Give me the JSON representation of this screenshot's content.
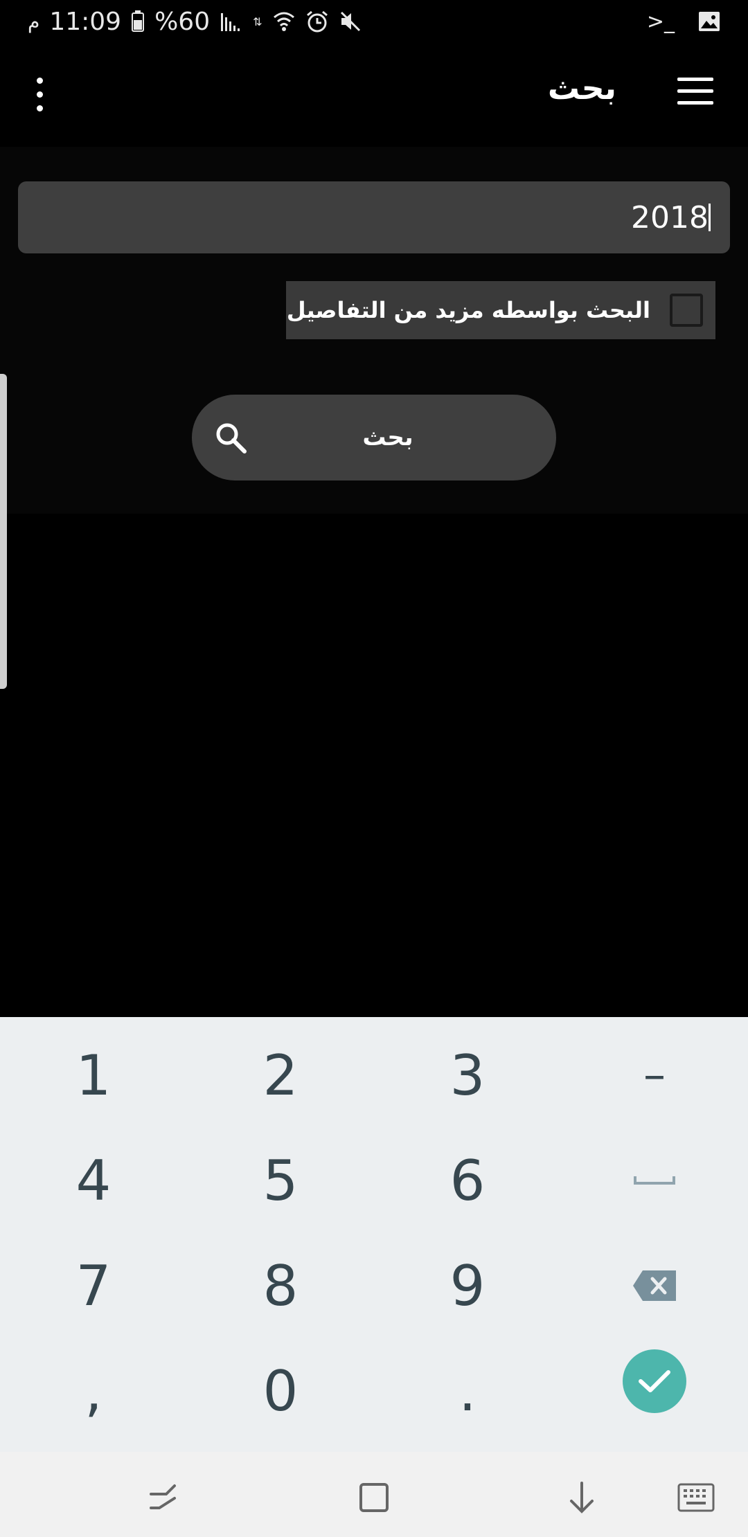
{
  "status_bar": {
    "time": "11:09",
    "period": "م",
    "battery_percent": "%60",
    "icons": [
      "signal-icon",
      "data-off-icon",
      "wifi-icon",
      "alarm-icon",
      "mute-icon",
      "terminal-icon",
      "image-icon"
    ]
  },
  "toolbar": {
    "title": "بحث",
    "menu_icon": "hamburger-menu-icon",
    "overflow_icon": "more-vert-icon"
  },
  "search": {
    "query": "2018",
    "checkbox_label": "البحث بواسطه مزيد من التفاصيل",
    "checkbox_checked": false,
    "button_label": "بحث"
  },
  "keyboard": {
    "rows": [
      [
        "1",
        "2",
        "3",
        "–"
      ],
      [
        "4",
        "5",
        "6",
        "␣"
      ],
      [
        "7",
        "8",
        "9",
        "⌫"
      ],
      [
        ",",
        "0",
        ".",
        "✓"
      ]
    ],
    "done_color": "#4db6ac"
  },
  "navbar": {
    "icons": [
      "recents-icon",
      "home-icon",
      "hide-keyboard-icon",
      "keyboard-switch-icon"
    ]
  }
}
